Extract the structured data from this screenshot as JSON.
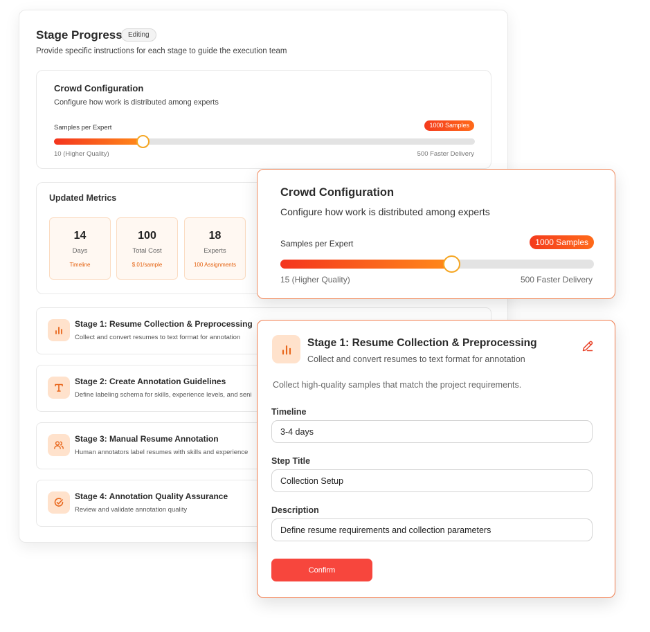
{
  "stage_progress": {
    "title": "Stage Progress",
    "badge": "Editing",
    "subtitle": "Provide specific instructions for each stage to guide the execution team"
  },
  "crowd_config_small": {
    "title": "Crowd Configuration",
    "subtitle": "Configure how work is distributed among experts",
    "slider_label": "Samples per Expert",
    "value_badge": "1000 Samples",
    "min_label": "10 (Higher Quality)",
    "max_label": "500 Faster Delivery",
    "slider_fraction": 0.21
  },
  "metrics": {
    "title": "Updated Metrics",
    "cards": [
      {
        "value": "14",
        "label": "Days",
        "sub": "Timeline"
      },
      {
        "value": "100",
        "label": "Total Cost",
        "sub": "$.01/sample"
      },
      {
        "value": "18",
        "label": "Experts",
        "sub": "100 Assignments"
      }
    ]
  },
  "stages": [
    {
      "title": "Stage 1: Resume Collection & Preprocessing",
      "desc": "Collect and convert resumes to text format for annotation",
      "icon": "bar-chart-icon"
    },
    {
      "title": "Stage 2: Create Annotation Guidelines",
      "desc": "Define labeling schema for skills, experience levels, and seni",
      "icon": "text-icon"
    },
    {
      "title": "Stage 3: Manual Resume Annotation",
      "desc": "Human annotators label resumes with skills and experience",
      "icon": "users-icon"
    },
    {
      "title": "Stage 4: Annotation Quality Assurance",
      "desc": "Review and validate annotation quality",
      "icon": "check-circle-icon"
    }
  ],
  "crowd_config_large": {
    "title": "Crowd Configuration",
    "subtitle": "Configure how work is distributed among experts",
    "slider_label": "Samples per Expert",
    "value_badge": "1000 Samples",
    "min_label": "15 (Higher Quality)",
    "max_label": "500 Faster Delivery",
    "slider_fraction": 0.545
  },
  "stage_editor": {
    "title": "Stage 1: Resume Collection & Preprocessing",
    "subtitle": "Collect and convert resumes to text format for annotation",
    "intro": "Collect high-quality samples that match the project requirements.",
    "fields": {
      "timeline": {
        "label": "Timeline",
        "value": "3-4 days"
      },
      "step_title": {
        "label": "Step Title",
        "value": "Collection Setup"
      },
      "description": {
        "label": "Description",
        "value": "Define resume requirements and collection parameters"
      }
    },
    "confirm_label": "Confirm"
  },
  "colors": {
    "accent": "#f4511e",
    "icon_bg": "#ffe2cc",
    "confirm": "#f7463d"
  }
}
